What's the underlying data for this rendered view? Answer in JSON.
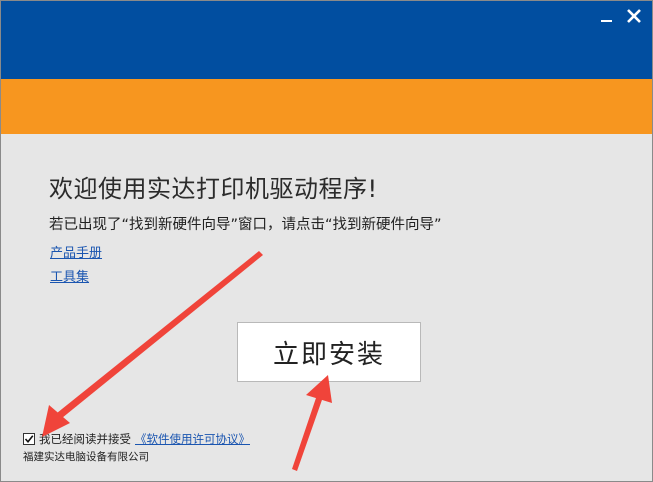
{
  "window": {
    "colors": {
      "titlebar": "#014ea0",
      "orange_band": "#f7961f",
      "body": "#e6e6e6",
      "link": "#1a55b0",
      "annotation_arrow": "#f0443a"
    },
    "controls": {
      "minimize_icon": "minimize-icon",
      "close_icon": "close-icon"
    }
  },
  "content": {
    "title": "欢迎使用实达打印机驱动程序!",
    "instruction": "若已出现了“找到新硬件向导”窗口，请点击“找到新硬件向导”",
    "links": {
      "manual": "产品手册",
      "tools": "工具集"
    },
    "install_button": "立即安装"
  },
  "footer": {
    "agree_checked": true,
    "agree_text": "我已经阅读并接受",
    "license_link": "《软件使用许可协议》",
    "company": "福建实达电脑设备有限公司"
  }
}
